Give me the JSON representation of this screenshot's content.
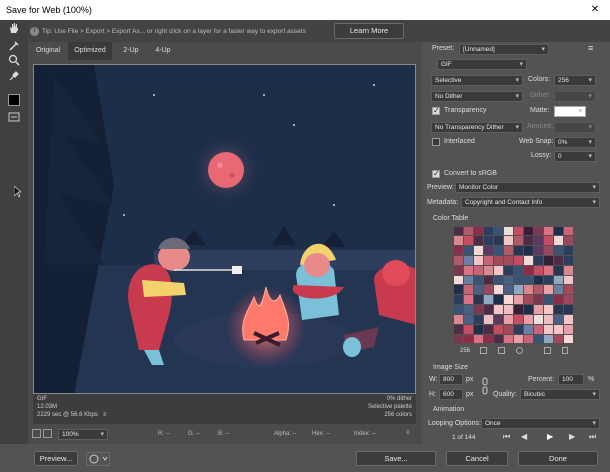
{
  "window": {
    "title": "Save for Web (100%)",
    "close": "✕"
  },
  "tip": {
    "icon": "i",
    "text": "Tip: Use File > Export > Export As... or right click on a layer for a faster way to export assets",
    "learn_more": "Learn More"
  },
  "tools": [
    "hand-tool",
    "slice-select-tool",
    "zoom-tool",
    "eyedropper-tool",
    "eyedropper-color",
    "toggle-slices-visibility"
  ],
  "tabs": [
    "Original",
    "Optimized",
    "2-Up",
    "4-Up"
  ],
  "active_tab": "Optimized",
  "image_info": {
    "left": [
      "GIF",
      "12.03M",
      "2229 sec @ 56.6 Kbps"
    ],
    "left_menu": "≡",
    "right": [
      "0% dither",
      "Selective palette",
      "256 colors"
    ]
  },
  "status": {
    "zoom": "100%",
    "r": "R: --",
    "g": "G: --",
    "b": "B: --",
    "alpha": "Alpha: --",
    "hex": "Hex: --",
    "index": "Index: --"
  },
  "settings": {
    "preset_label": "Preset:",
    "preset_value": "[Unnamed]",
    "format": "GIF",
    "reduction": "Selective",
    "colors_label": "Colors:",
    "colors_value": "256",
    "dither_algo": "No Dither",
    "dither_label": "Dither:",
    "transparency": "Transparency",
    "matte_label": "Matte:",
    "trans_dither": "No Transparency Dither",
    "amount_label": "Amount:",
    "interlaced": "Interlaced",
    "web_snap_label": "Web Snap:",
    "web_snap_value": "0%",
    "lossy_label": "Lossy:",
    "lossy_value": "0",
    "convert_srgb": "Convert to sRGB",
    "preview_label": "Preview:",
    "preview_value": "Monitor Color",
    "metadata_label": "Metadata:",
    "metadata_value": "Copyright and Contact Info",
    "color_table_label": "Color Table",
    "color_count": "256"
  },
  "image_size": {
    "label": "Image Size",
    "w_label": "W:",
    "w_value": "800",
    "w_unit": "px",
    "h_label": "H:",
    "h_value": "600",
    "h_unit": "px",
    "percent_label": "Percent:",
    "percent_value": "100",
    "percent_unit": "%",
    "quality_label": "Quality:",
    "quality_value": "Bicubic"
  },
  "animation": {
    "label": "Animation",
    "looping_label": "Looping Options:",
    "looping_value": "Once",
    "frame": "1 of 144"
  },
  "footer": {
    "preview": "Preview...",
    "save": "Save...",
    "cancel": "Cancel",
    "done": "Done"
  },
  "colors": {
    "palette": [
      "#e8a0a8",
      "#c44d63",
      "#8a2f49",
      "#f2c6c9",
      "#5a3a5e",
      "#2d3e5c",
      "#1f2f4a",
      "#6b7fa0",
      "#a04a5c",
      "#d97384",
      "#3b5372",
      "#4d2d45",
      "#e9e0dc",
      "#b05a6a",
      "#7a3850",
      "#d8888f",
      "#2a3650",
      "#90a8c0",
      "#c86478",
      "#edbfc4",
      "#4a6080",
      "#381e35",
      "#f5d8d8",
      "#9a4860"
    ]
  }
}
